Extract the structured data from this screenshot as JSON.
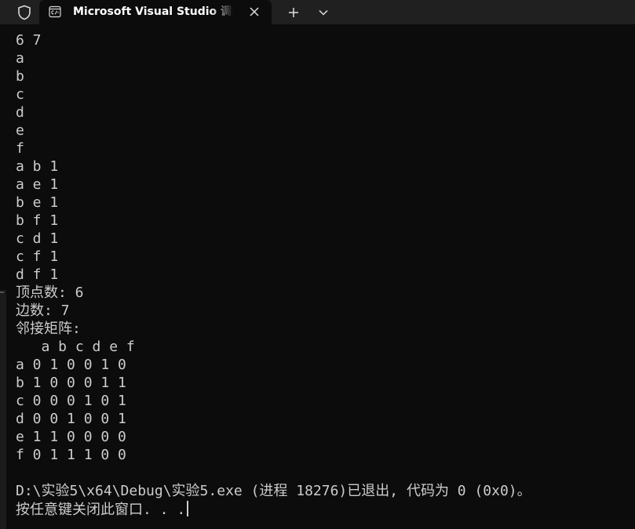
{
  "tab": {
    "title": "Microsoft Visual Studio 调试控制台"
  },
  "terminal": {
    "output_lines": "6 7\na\nb\nc\nd\ne\nf\na b 1\na e 1\nb e 1\nb f 1\nc d 1\nc f 1\nd f 1\n顶点数: 6\n边数: 7\n邻接矩阵:\n   a b c d e f\na 0 1 0 0 1 0\nb 1 0 0 0 1 1\nc 0 0 0 1 0 1\nd 0 0 1 0 0 1\ne 1 1 0 0 0 0\nf 0 1 1 1 0 0",
    "exit_message": "D:\\实验5\\x64\\Debug\\实验5.exe (进程 18276)已退出, 代码为 0 (0x0)。",
    "prompt": "按任意键关闭此窗口. . ."
  },
  "colors": {
    "background": "#0c0c0c",
    "tabbar": "#202020",
    "text": "#cccccc"
  },
  "icons": {
    "shield": "shield-icon",
    "tab": "console-app-icon",
    "close": "close-icon",
    "new_tab": "plus-icon",
    "dropdown": "chevron-down-icon"
  }
}
